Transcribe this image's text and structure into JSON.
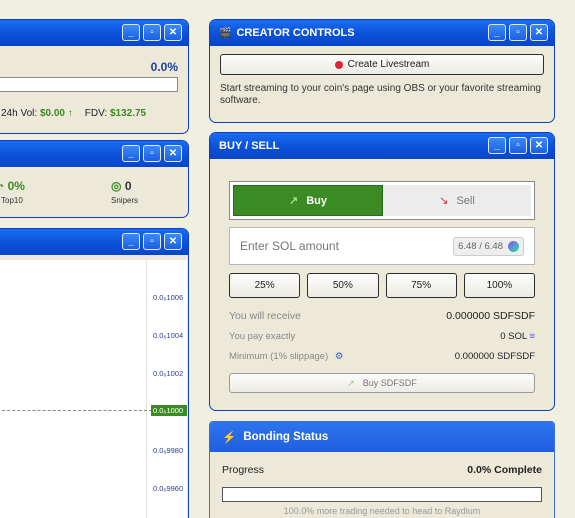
{
  "top_left_window": {
    "percent": "0.0%",
    "vol_label": "24h Vol:",
    "vol_value": "$0.00",
    "vol_arrow": "↑",
    "fdv_label": "FDV:",
    "fdv_value": "$132.75"
  },
  "holders_window": {
    "top10_value": "0%",
    "top10_label": "Top10",
    "snipers_value": "0",
    "snipers_label": "Snipers"
  },
  "chart_window": {
    "ticks": [
      "0.0₆1006",
      "0.0₆1004",
      "0.0₆1002",
      "0.0₆1000",
      "0.0₆9980",
      "0.0₆9960"
    ],
    "current_tick": "0.0₆1000"
  },
  "creator_controls": {
    "title": "CREATOR CONTROLS",
    "icon": "clapperboard-icon",
    "button_label": "Create Livestream",
    "description": "Start streaming to your coin's page using OBS or your favorite streaming software."
  },
  "buy_sell": {
    "title": "BUY / SELL",
    "buy_tab": "Buy",
    "sell_tab": "Sell",
    "amount_placeholder": "Enter SOL amount",
    "balance": "6.48 / 6.48",
    "presets": [
      "25%",
      "50%",
      "75%",
      "100%"
    ],
    "receive_label": "You will receive",
    "receive_value": "0.000000 SDFSDF",
    "pay_label": "You pay exactly",
    "pay_value": "0 SOL",
    "minimum_label": "Minimum (1% slippage)",
    "minimum_value": "0.000000 SDFSDF",
    "buy_button": "Buy SDFSDF",
    "colors": {
      "buy_active": "#3b8a24",
      "sell_arrow": "#d23030"
    }
  },
  "bonding": {
    "title": "Bonding Status",
    "progress_label": "Progress",
    "progress_value": "0.0% Complete",
    "progress_fraction": 0.0,
    "footer_text": "100.0% more trading needed to head to Raydium"
  },
  "window_buttons": {
    "minimize": "_",
    "maximize": "▫",
    "close": "✕"
  }
}
